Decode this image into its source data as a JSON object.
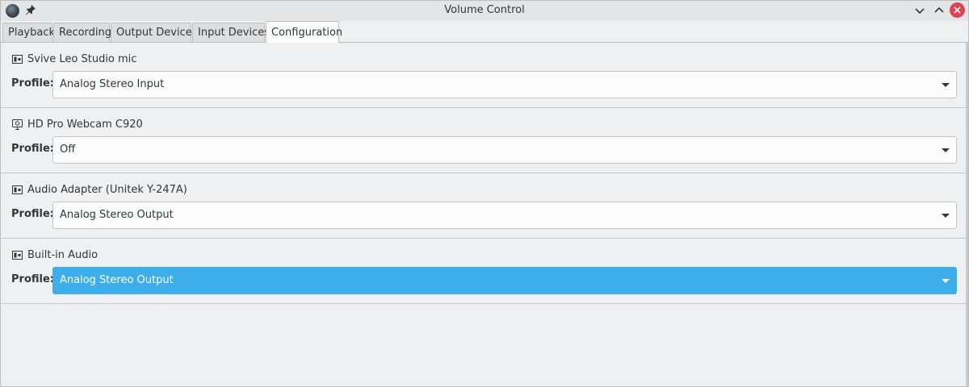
{
  "window": {
    "title": "Volume Control",
    "icons": {
      "app": "pavucontrol-icon",
      "pin": "pin-icon",
      "minimize": "chevron-down-icon",
      "maximize": "chevron-up-icon",
      "close": "close-icon"
    },
    "colors": {
      "close_button": "#da4453",
      "highlight": "#3daee9"
    }
  },
  "tabs": [
    {
      "label": "Playback",
      "active": false
    },
    {
      "label": "Recording",
      "active": false
    },
    {
      "label": "Output Devices",
      "active": false
    },
    {
      "label": "Input Devices",
      "active": false
    },
    {
      "label": "Configuration",
      "active": true
    }
  ],
  "devices": [
    {
      "name": "Svive Leo Studio mic",
      "icon": "audio-card-icon",
      "profile_label": "Profile:",
      "profile": "Analog Stereo Input",
      "focused": false
    },
    {
      "name": "HD Pro Webcam C920",
      "icon": "webcam-icon",
      "profile_label": "Profile:",
      "profile": "Off",
      "focused": false
    },
    {
      "name": "Audio Adapter (Unitek Y-247A)",
      "icon": "audio-card-icon",
      "profile_label": "Profile:",
      "profile": "Analog Stereo Output",
      "focused": false
    },
    {
      "name": "Built-in Audio",
      "icon": "audio-card-icon",
      "profile_label": "Profile:",
      "profile": "Analog Stereo Output",
      "focused": true
    }
  ]
}
